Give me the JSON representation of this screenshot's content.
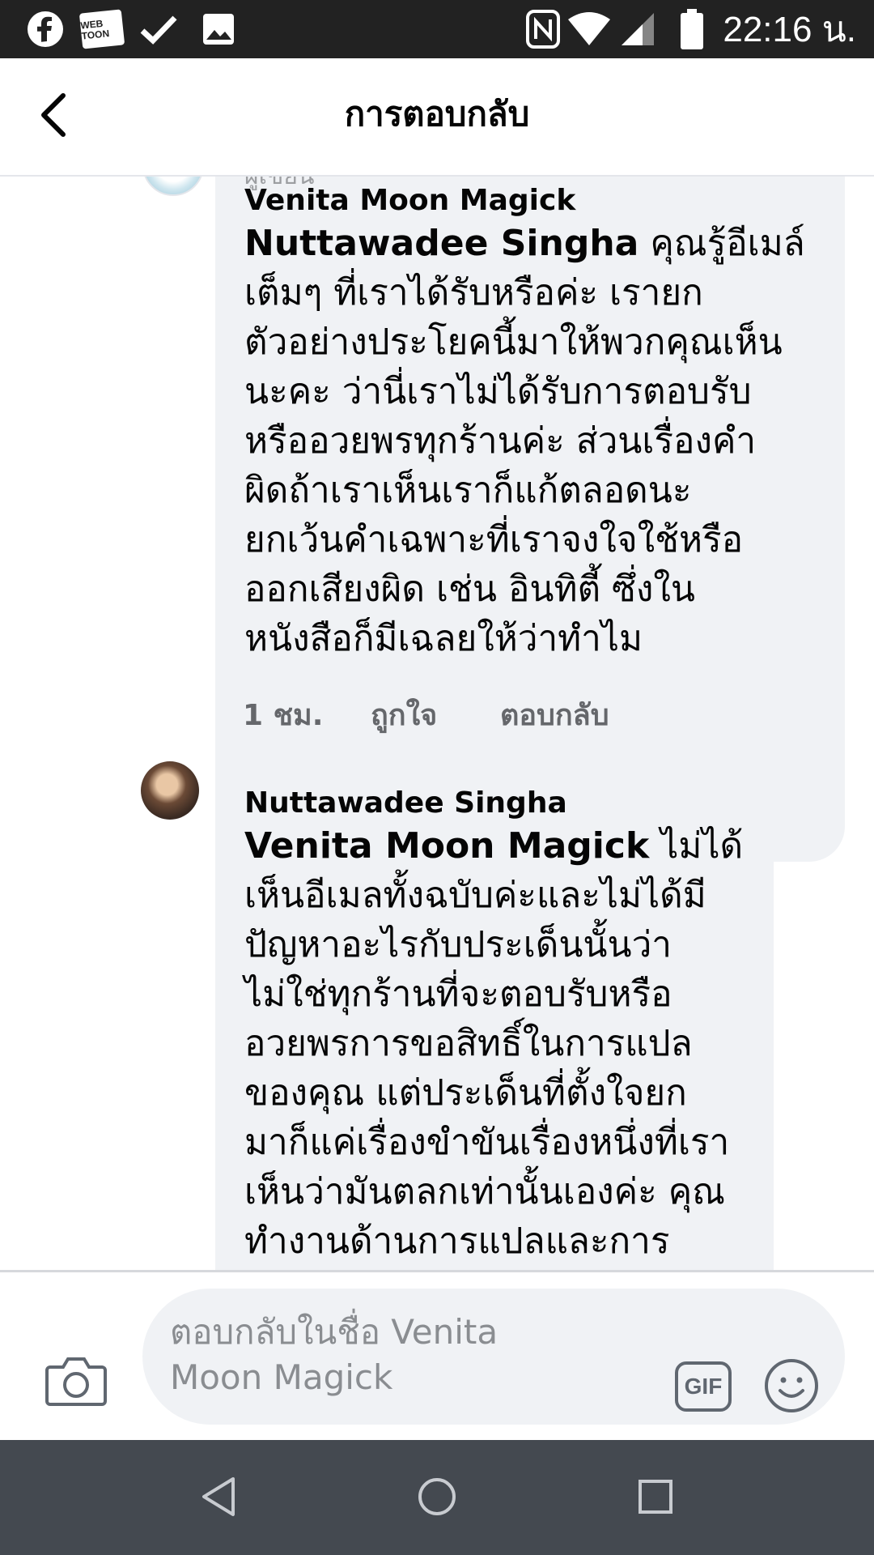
{
  "status_bar": {
    "time": "22:16 น.",
    "icons": [
      "facebook-icon",
      "webtoon-icon",
      "check-icon",
      "image-icon",
      "nfc-icon",
      "wifi-icon",
      "signal-icon",
      "battery-icon"
    ],
    "webtoon_text": "WEB TOON"
  },
  "header": {
    "title": "การตอบกลับ",
    "back_icon": "back-arrow-icon"
  },
  "comments": [
    {
      "faded_label": "ผู้เขียน",
      "author": "Venita Moon Magick",
      "mention": "Nuttawadee Singha",
      "text_lines": [
        "คุณรู้อีเมล์",
        "เต็มๆ ที่เราได้รับหรือค่ะ เรายก",
        "ตัวอย่างประโยคนี้มาให้พวกคุณเห็น",
        "นะคะ ว่านี่เราไม่ได้รับการตอบรับ",
        "หรืออวยพรทุกร้านค่ะ ส่วนเรื่องคำ",
        "ผิดถ้าเราเห็นเราก็แก้ตลอดนะ",
        "ยกเว้นคำเฉพาะที่เราจงใจใช้หรือ",
        "ออกเสียงผิด เช่น อินทิตี้ ซึ่งใน",
        "หนังสือก็มีเฉลยให้ว่าทำไม"
      ],
      "time": "1 ชม.",
      "like_label": "ถูกใจ",
      "reply_label": "ตอบกลับ"
    },
    {
      "author": "Nuttawadee Singha",
      "mention": "Venita Moon Magick",
      "text_lines": [
        "ไม่ได้",
        "เห็นอีเมลทั้งฉบับค่ะและไม่ได้มี",
        "ปัญหาอะไรกับประเด็นนั้นว่า",
        "ไม่ใช่ทุกร้านที่จะตอบรับหรือ",
        "อวยพรการขอสิทธิ์ในการแปล",
        "ของคุณ แต่ประเด็นที่ตั้งใจยก",
        "มาก็แค่เรื่องขำขันเรื่องหนึ่งที่เรา",
        "เห็นว่ามันตลกเท่านั้นเองค่ะ คุณ",
        "ทำงานด้านการแปลและการ"
      ]
    }
  ],
  "composer": {
    "placeholder_line1": "ตอบกลับในชื่อ Venita",
    "placeholder_line2": "Moon Magick",
    "gif_label": "GIF",
    "camera_icon": "camera-icon",
    "emoji_icon": "emoji-icon"
  },
  "nav_bar": {
    "buttons": [
      "back-triangle-icon",
      "home-circle-icon",
      "recents-square-icon"
    ]
  }
}
